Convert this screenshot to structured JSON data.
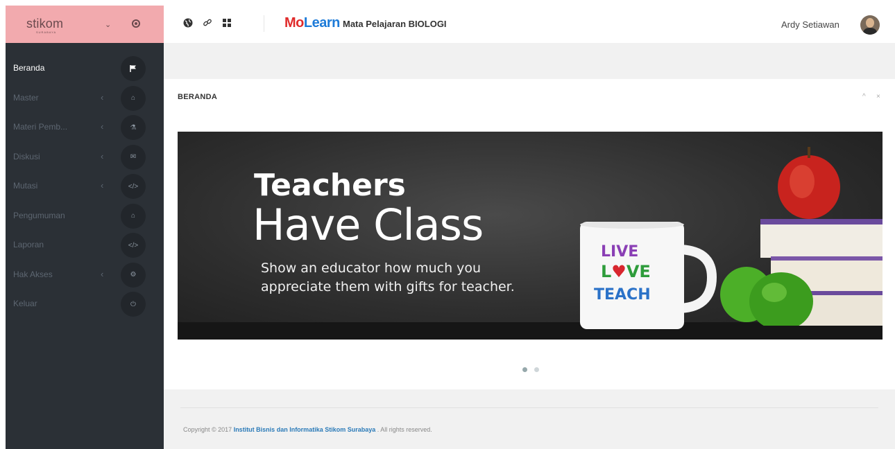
{
  "brand": {
    "logo": "stikom",
    "subtitle": "SURABAYA"
  },
  "sidebar": {
    "items": [
      {
        "label": "Beranda",
        "icon": "flag-icon",
        "glyph": "⚑",
        "caret": ""
      },
      {
        "label": "Master",
        "icon": "home-icon",
        "glyph": "⌂",
        "caret": "‹"
      },
      {
        "label": "Materi Pemb...",
        "icon": "flask-icon",
        "glyph": "⚗",
        "caret": "‹"
      },
      {
        "label": "Diskusi",
        "icon": "comments-icon",
        "glyph": "✉",
        "caret": "‹"
      },
      {
        "label": "Mutasi",
        "icon": "code-icon",
        "glyph": "</>",
        "caret": "‹"
      },
      {
        "label": "Pengumuman",
        "icon": "home-icon",
        "glyph": "⌂",
        "caret": ""
      },
      {
        "label": "Laporan",
        "icon": "code-icon",
        "glyph": "</>",
        "caret": ""
      },
      {
        "label": "Hak Akses",
        "icon": "cogs-icon",
        "glyph": "⚙",
        "caret": "‹"
      },
      {
        "label": "Keluar",
        "icon": "power-icon",
        "glyph": "⏻",
        "caret": ""
      }
    ]
  },
  "header": {
    "app_mo": "Mo",
    "app_learn": "Learn",
    "subject": "Mata Pelajaran BIOLOGI",
    "username": "Ardy Setiawan"
  },
  "panel": {
    "title": "BERANDA"
  },
  "banner": {
    "headline": "Teachers",
    "subheadline": "Have Class",
    "line1": "Show an educator how much you",
    "line2": "appreciate them with gifts for teacher.",
    "mug_text": "LIVE LOVE TEACH"
  },
  "slider": {
    "active_index": 0,
    "count": 2
  },
  "footer": {
    "prefix": "Copyright © 2017 ",
    "link": "Institut Bisnis dan Informatika Stikom Surabaya",
    "suffix": " . All rights reserved."
  },
  "colors": {
    "sidebar_bg": "#2b3036",
    "brand_bg": "#f2aaae",
    "accent_red": "#e02b2b",
    "accent_blue": "#1d7bd8"
  }
}
